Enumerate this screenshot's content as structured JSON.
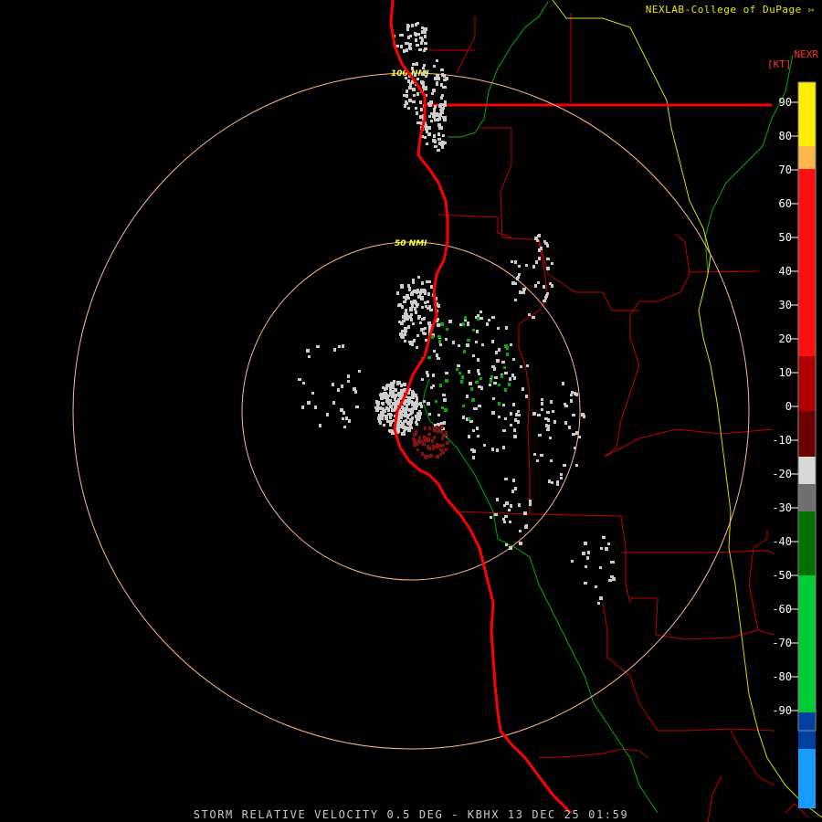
{
  "credit": "NEXLAB-College of DuPage",
  "credit_icon": "corner-arrow-icon",
  "product": "NEXR",
  "units": "[KT]",
  "caption": "STORM RELATIVE VELOCITY 0.5 DEG - KBHX 13 DEC 25 01:59",
  "range_rings": [
    {
      "label": "50 NMI"
    },
    {
      "label": "100 NMI"
    }
  ],
  "legend": {
    "ticks": [
      "90",
      "80",
      "70",
      "60",
      "50",
      "40",
      "30",
      "20",
      "10",
      "0",
      "-10",
      "-20",
      "-30",
      "-40",
      "-50",
      "-60",
      "-70",
      "-80",
      "-90"
    ],
    "segments": [
      {
        "color": "#fff000"
      },
      {
        "color": "#fcb74a"
      },
      {
        "color": "#ff1010"
      },
      {
        "color": "#b00000"
      },
      {
        "color": "#6a0000"
      },
      {
        "color": "#d8d8d8"
      },
      {
        "color": "#707070"
      },
      {
        "color": "#007000"
      },
      {
        "color": "#00cc33"
      },
      {
        "color": "#0040a0"
      },
      {
        "color": "#1a9cff"
      }
    ]
  },
  "colors": {
    "background": "#000000",
    "coastline": "#ff0000",
    "county_lines": "#cc0000",
    "state_line": "#ffff00",
    "rivers": "#00b000",
    "range_rings": "#ffb888",
    "inbound_echo": "#00b000",
    "outbound_echo": "#8a1010",
    "near_zero_echo": "#cccccc"
  }
}
